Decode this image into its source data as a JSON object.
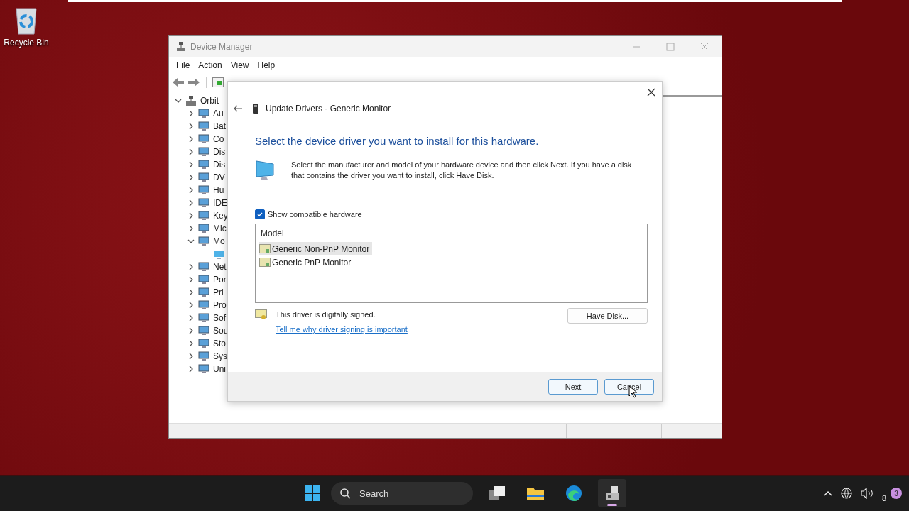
{
  "desktop_icons": [
    {
      "label": "Recycle Bin"
    }
  ],
  "window": {
    "title": "Device Manager",
    "menu": [
      "File",
      "Action",
      "View",
      "Help"
    ],
    "tree": {
      "label": "Orbit",
      "expanded": true,
      "children": [
        {
          "label": "Au",
          "expanded": false
        },
        {
          "label": "Bat",
          "expanded": false
        },
        {
          "label": "Co",
          "expanded": false
        },
        {
          "label": "Dis",
          "expanded": false
        },
        {
          "label": "Dis",
          "expanded": false
        },
        {
          "label": "DV",
          "expanded": false
        },
        {
          "label": "Hu",
          "expanded": false
        },
        {
          "label": "IDE",
          "expanded": false
        },
        {
          "label": "Key",
          "expanded": false
        },
        {
          "label": "Mic",
          "expanded": false
        },
        {
          "label": "Mo",
          "expanded": true,
          "children": [
            {
              "kind": "monitor"
            }
          ]
        },
        {
          "label": "Net",
          "expanded": false
        },
        {
          "label": "Por",
          "expanded": false
        },
        {
          "label": "Pri",
          "expanded": false
        },
        {
          "label": "Pro",
          "expanded": false
        },
        {
          "label": "Sof",
          "expanded": false
        },
        {
          "label": "Sou",
          "expanded": false
        },
        {
          "label": "Sto",
          "expanded": false
        },
        {
          "label": "Sys",
          "expanded": false
        },
        {
          "label": "Uni",
          "expanded": false
        }
      ]
    }
  },
  "dialog": {
    "title": "Update Drivers - Generic Monitor",
    "heading": "Select the device driver you want to install for this hardware.",
    "description": "Select the manufacturer and model of your hardware device and then click Next. If you have a disk that contains the driver you want to install, click Have Disk.",
    "show_compatible": {
      "label": "Show compatible hardware",
      "checked": true
    },
    "model_list": {
      "header": "Model",
      "items": [
        {
          "label": "Generic Non-PnP Monitor",
          "selected": true
        },
        {
          "label": "Generic PnP Monitor",
          "selected": false
        }
      ]
    },
    "signed_text": "This driver is digitally signed.",
    "signing_link": "Tell me why driver signing is important",
    "have_disk": "Have Disk...",
    "buttons": [
      "Next",
      "Cancel"
    ]
  },
  "taskbar": {
    "search": {
      "placeholder": "Search"
    },
    "apps": [
      {
        "kind": "task-view",
        "active": false
      },
      {
        "kind": "folder",
        "active": false
      },
      {
        "kind": "browser",
        "active": false
      },
      {
        "kind": "device-manager",
        "active": true
      }
    ],
    "tray_count": "8",
    "notification_badge": "3"
  }
}
